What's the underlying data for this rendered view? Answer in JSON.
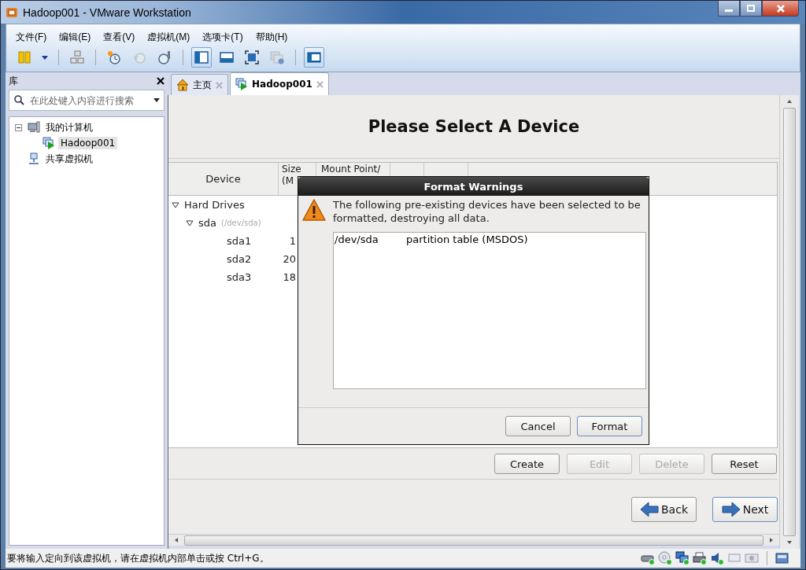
{
  "window": {
    "title": "Hadoop001 - VMware Workstation"
  },
  "menu": [
    {
      "label": "文件(F)"
    },
    {
      "label": "编辑(E)"
    },
    {
      "label": "查看(V)"
    },
    {
      "label": "虚拟机(M)"
    },
    {
      "label": "选项卡(T)"
    },
    {
      "label": "帮助(H)"
    }
  ],
  "toolbar_groups": [
    {
      "buttons": [
        {
          "kind": "pause",
          "selected": false,
          "disabled": false
        },
        {
          "kind": "dropdown",
          "selected": false,
          "disabled": false
        }
      ]
    },
    {
      "buttons": [
        {
          "kind": "team",
          "selected": false,
          "disabled": false
        }
      ]
    },
    {
      "buttons": [
        {
          "kind": "snapshot",
          "selected": false,
          "disabled": false
        },
        {
          "kind": "revert",
          "selected": false,
          "disabled": true
        },
        {
          "kind": "manager",
          "selected": false,
          "disabled": false
        }
      ]
    },
    {
      "buttons": [
        {
          "kind": "console",
          "selected": true,
          "disabled": false
        },
        {
          "kind": "tabs",
          "selected": false,
          "disabled": false
        },
        {
          "kind": "fullscreen",
          "selected": false,
          "disabled": false
        },
        {
          "kind": "unity",
          "selected": false,
          "disabled": true
        }
      ]
    },
    {
      "buttons": [
        {
          "kind": "thumbnails",
          "selected": true,
          "disabled": false
        }
      ]
    }
  ],
  "library": {
    "title": "库",
    "search": {
      "placeholder": "在此处键入内容进行搜索"
    },
    "tree": [
      {
        "label": "我的计算机",
        "kind": "computer",
        "selected": false,
        "expanded": true,
        "children": [
          {
            "label": "Hadoop001",
            "kind": "vm",
            "selected": true
          }
        ]
      },
      {
        "label": "共享虚拟机",
        "kind": "shared",
        "selected": false
      }
    ]
  },
  "tabs": [
    {
      "label": "主页",
      "kind": "home",
      "selected": false
    },
    {
      "label": "Hadoop001",
      "kind": "vm",
      "selected": true
    }
  ],
  "installer": {
    "heading": "Please Select A Device",
    "columns": [
      "Device",
      "Size (M",
      "Mount Point/"
    ],
    "rows": [
      {
        "device": "Hard Drives",
        "expanded": true,
        "children": [
          {
            "device": "sda",
            "note": "(/dev/sda)",
            "expanded": true,
            "children": [
              {
                "device": "sda1",
                "size": "1"
              },
              {
                "device": "sda2",
                "size": "20"
              },
              {
                "device": "sda3",
                "size": "18"
              }
            ]
          }
        ]
      }
    ],
    "buttons": [
      {
        "label": "Create",
        "disabled": false
      },
      {
        "label": "Edit",
        "disabled": true
      },
      {
        "label": "Delete",
        "disabled": true
      },
      {
        "label": "Reset",
        "disabled": false
      }
    ],
    "nav": [
      {
        "label": "Back",
        "kind": "back",
        "focused": false
      },
      {
        "label": "Next",
        "kind": "next",
        "focused": true
      }
    ]
  },
  "dialog": {
    "title": "Format Warnings",
    "message": "The following pre-existing devices have been selected to be formatted, destroying all data.",
    "items": [
      {
        "device": "/dev/sda",
        "description": "partition table (MSDOS)"
      }
    ],
    "buttons": [
      {
        "label": "Cancel",
        "focused": false
      },
      {
        "label": "Format",
        "focused": true
      }
    ]
  },
  "status_bar": {
    "message": "要将输入定向到该虚拟机，请在虚拟机内部单击或按 Ctrl+G。",
    "devices": [
      {
        "kind": "disk",
        "connected": true
      },
      {
        "kind": "cd",
        "connected": true
      },
      {
        "kind": "network",
        "connected": true
      },
      {
        "kind": "printer",
        "connected": true
      },
      {
        "kind": "sound",
        "connected": true
      },
      {
        "kind": "usb",
        "connected": false
      },
      {
        "kind": "camera",
        "connected": false
      }
    ]
  }
}
